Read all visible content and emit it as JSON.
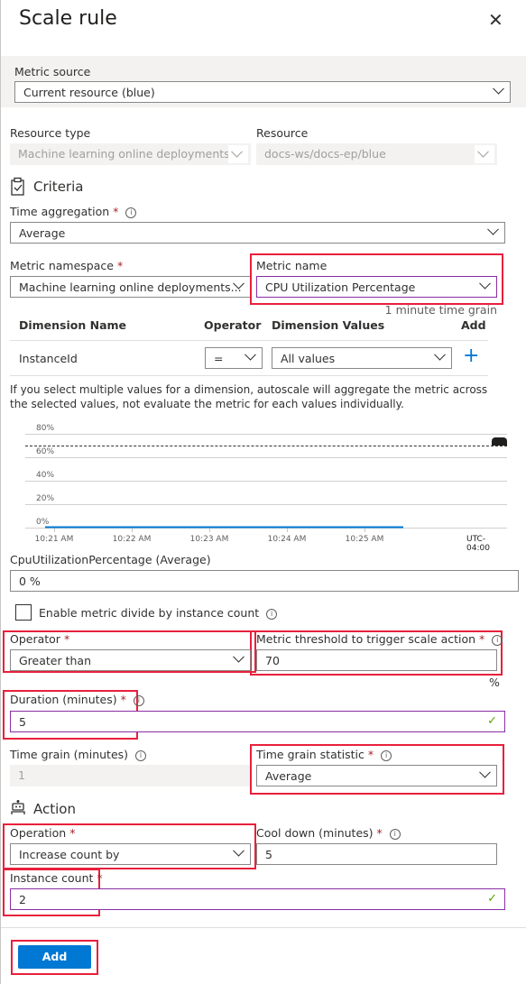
{
  "title": "Scale rule",
  "metric_source": {
    "label": "Metric source",
    "value": "Current resource (blue)"
  },
  "resource_type": {
    "label": "Resource type",
    "value": "Machine learning online deployments"
  },
  "resource": {
    "label": "Resource",
    "value": "docs-ws/docs-ep/blue"
  },
  "criteria": {
    "heading": "Criteria"
  },
  "time_aggregation": {
    "label": "Time aggregation",
    "value": "Average"
  },
  "metric_namespace": {
    "label": "Metric namespace",
    "value": "Machine learning online deployments..."
  },
  "metric_name": {
    "label": "Metric name",
    "value": "CPU Utilization Percentage",
    "note": "1 minute time grain"
  },
  "dimensions": {
    "headers": [
      "Dimension Name",
      "Operator",
      "Dimension Values",
      "Add"
    ],
    "rows": [
      {
        "name": "InstanceId",
        "operator": "=",
        "values": "All values"
      }
    ]
  },
  "dimension_note": "If you select multiple values for a dimension, autoscale will aggregate the metric across the selected values, not evaluate the metric for each values individually.",
  "chart_data": {
    "type": "line",
    "y_ticks": [
      "80%",
      "60%",
      "40%",
      "20%",
      "0%"
    ],
    "ylim": [
      0,
      80
    ],
    "x_ticks": [
      "10:21 AM",
      "10:22 AM",
      "10:23 AM",
      "10:24 AM",
      "10:25 AM"
    ],
    "timezone": "UTC-04:00",
    "threshold": 70,
    "series": [
      {
        "name": "CpuUtilizationPercentage",
        "values": [
          0,
          0,
          0,
          0,
          0,
          0
        ]
      }
    ]
  },
  "current_value": {
    "label": "CpuUtilizationPercentage (Average)",
    "value": "0 %"
  },
  "divide_checkbox": {
    "label": "Enable metric divide by instance count",
    "checked": false
  },
  "operator": {
    "label": "Operator",
    "value": "Greater than"
  },
  "threshold": {
    "label": "Metric threshold to trigger scale action",
    "value": "70",
    "unit": "%"
  },
  "duration": {
    "label": "Duration (minutes)",
    "value": "5"
  },
  "time_grain": {
    "label": "Time grain (minutes)",
    "value": "1"
  },
  "time_grain_statistic": {
    "label": "Time grain statistic",
    "value": "Average"
  },
  "action": {
    "heading": "Action"
  },
  "operation": {
    "label": "Operation",
    "value": "Increase count by"
  },
  "cool_down": {
    "label": "Cool down (minutes)",
    "value": "5"
  },
  "instance_count": {
    "label": "Instance count",
    "value": "2"
  },
  "add_button": "Add",
  "req": "*",
  "colors": {
    "accent": "#0078d4",
    "highlight": "#e8203c",
    "focus": "#8a2da5"
  }
}
